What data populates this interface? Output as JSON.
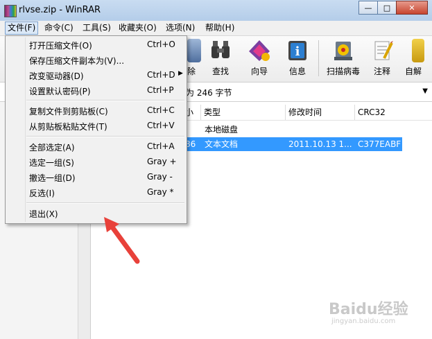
{
  "window": {
    "title": "rlvse.zip - WinRAR",
    "minimize": "—",
    "maximize": "□",
    "close": "✕"
  },
  "menubar": [
    "文件(F)",
    "命令(C)",
    "工具(S)",
    "收藏夹(O)",
    "选项(N)",
    "帮助(H)"
  ],
  "toolbar": {
    "labels": [
      "除",
      "查找",
      "向导",
      "信息",
      "扫描病毒",
      "注释",
      "自解"
    ],
    "icon_names": [
      "delete-icon",
      "find-icon",
      "wizard-icon",
      "info-icon",
      "virus-scan-icon",
      "comment-icon",
      "sfx-icon"
    ]
  },
  "path_bar": {
    "text": "为 246 字节"
  },
  "file_list": {
    "headers": [
      "小",
      "类型",
      "修改时间",
      "CRC32"
    ],
    "rows": [
      {
        "size": "",
        "type": "本地磁盘",
        "modified": "",
        "crc": ""
      },
      {
        "size": "86",
        "type": "文本文档",
        "modified": "2011.10.13 1...",
        "crc": "C377EABF"
      }
    ]
  },
  "file_menu": {
    "items": [
      {
        "label": "打开压缩文件(O)",
        "shortcut": "Ctrl+O"
      },
      {
        "label": "保存压缩文件副本为(V)...",
        "shortcut": ""
      },
      {
        "label": "改变驱动器(D)",
        "shortcut": "Ctrl+D"
      },
      {
        "label": "设置默认密码(P)",
        "shortcut": "Ctrl+P"
      },
      {
        "label": "复制文件到剪贴板(C)",
        "shortcut": "Ctrl+C"
      },
      {
        "label": "从剪贴板粘贴文件(T)",
        "shortcut": "Ctrl+V"
      },
      {
        "label": "全部选定(A)",
        "shortcut": "Ctrl+A"
      },
      {
        "label": "选定一组(S)",
        "shortcut": "Gray +"
      },
      {
        "label": "撤选一组(D)",
        "shortcut": "Gray -"
      },
      {
        "label": "反选(I)",
        "shortcut": "Gray *"
      },
      {
        "label": "退出(X)",
        "shortcut": ""
      }
    ],
    "submenu_arrow": "▶"
  },
  "watermark": {
    "text": "Baidu经验",
    "sub": "jingyan.baidu.com"
  },
  "colors": {
    "selection": "#3399ff",
    "annotation_arrow": "#e8413a"
  }
}
